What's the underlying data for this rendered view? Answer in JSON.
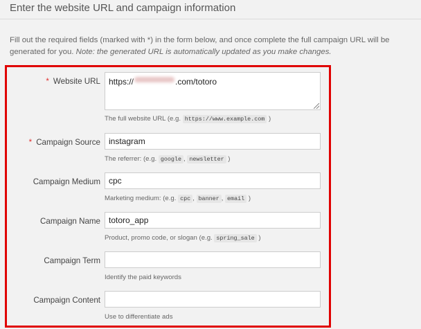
{
  "section": {
    "title": "Enter the website URL and campaign information"
  },
  "intro": {
    "text": "Fill out the required fields (marked with *) in the form below, and once complete the full campaign URL will be generated for you.",
    "note": "Note: the generated URL is automatically updated as you make changes."
  },
  "colors": {
    "highlight_border": "#e00000",
    "required_star": "#e03030",
    "background": "#f2f2f2"
  },
  "form": {
    "website_url": {
      "required": "*",
      "label": "Website URL",
      "value_prefix": "https://",
      "value_suffix": ".com/totoro",
      "help": "The full website URL (e.g.",
      "help_code": "https://www.example.com",
      "help_end": ")"
    },
    "campaign_source": {
      "required": "*",
      "label": "Campaign Source",
      "value": "instagram",
      "help": "The referrer: (e.g.",
      "help_code1": "google",
      "help_sep": ",",
      "help_code2": "newsletter",
      "help_end": ")"
    },
    "campaign_medium": {
      "label": "Campaign Medium",
      "value": "cpc",
      "help": "Marketing medium: (e.g.",
      "help_code1": "cpc",
      "help_sep": ",",
      "help_code2": "banner",
      "help_code3": "email",
      "help_end": ")"
    },
    "campaign_name": {
      "label": "Campaign Name",
      "value": "totoro_app",
      "help": "Product, promo code, or slogan (e.g.",
      "help_code": "spring_sale",
      "help_end": ")"
    },
    "campaign_term": {
      "label": "Campaign Term",
      "value": "",
      "help": "Identify the paid keywords"
    },
    "campaign_content": {
      "label": "Campaign Content",
      "value": "",
      "help": "Use to differentiate ads"
    }
  }
}
